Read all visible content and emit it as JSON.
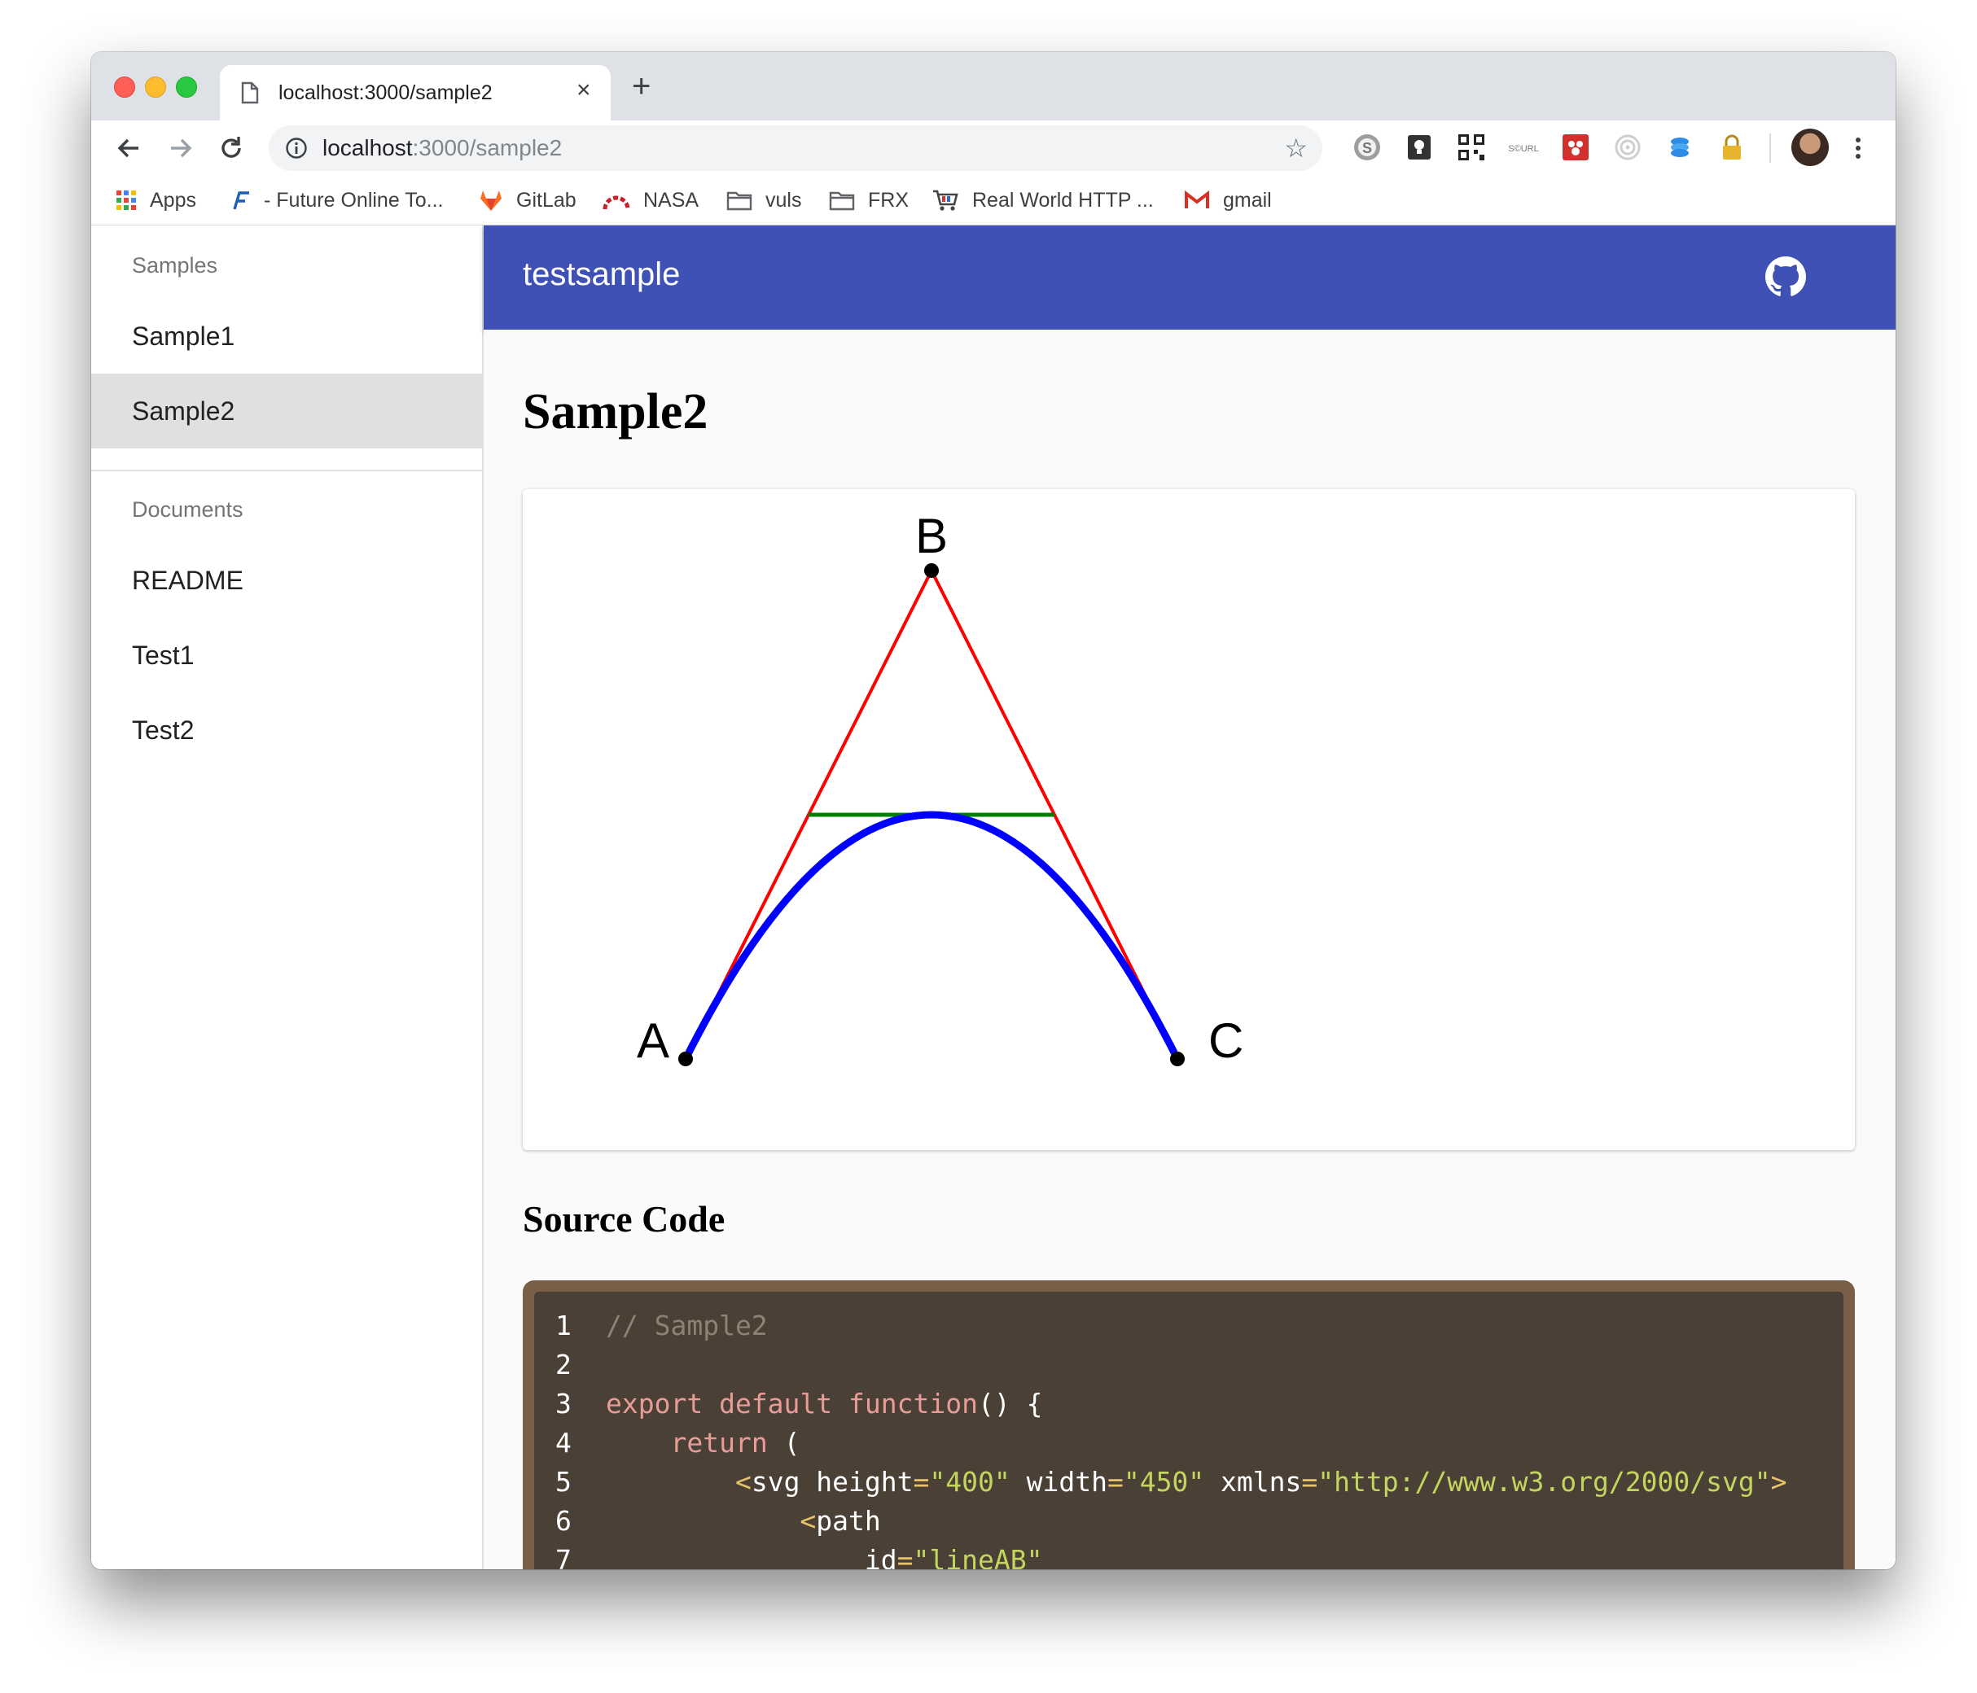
{
  "browser": {
    "tab_title": "localhost:3000/sample2",
    "tab_close": "×",
    "new_tab": "+",
    "url_host": "localhost",
    "url_rest": ":3000/sample2",
    "star": "☆",
    "bookmarks": [
      {
        "label": "Apps",
        "icon": "apps-grid-icon"
      },
      {
        "label": "- Future Online To...",
        "icon": "future-logo-icon"
      },
      {
        "label": "GitLab",
        "icon": "gitlab-icon"
      },
      {
        "label": "NASA",
        "icon": "nasa-arc-icon"
      },
      {
        "label": "vuls",
        "icon": "folder-icon"
      },
      {
        "label": "FRX",
        "icon": "folder-icon"
      },
      {
        "label": "Real World HTTP ...",
        "icon": "cart-icon"
      },
      {
        "label": "gmail",
        "icon": "gmail-icon"
      }
    ]
  },
  "sidebar": {
    "samples_header": "Samples",
    "samples": [
      "Sample1",
      "Sample2"
    ],
    "selected": "Sample2",
    "documents_header": "Documents",
    "documents": [
      "README",
      "Test1",
      "Test2"
    ]
  },
  "appbar": {
    "title": "testsample",
    "color": "#3f51b5"
  },
  "main": {
    "page_title": "Sample2",
    "section_title": "Source Code"
  },
  "diagram": {
    "labels": {
      "a": "A",
      "b": "B",
      "c": "C"
    },
    "colors": {
      "lines": "#ff0000",
      "mid": "#008000",
      "curve": "#0000ff",
      "points": "#000000"
    }
  },
  "code": {
    "lines": [
      {
        "n": "1",
        "parts": [
          [
            "c-comment",
            "// Sample2"
          ]
        ]
      },
      {
        "n": "2",
        "parts": []
      },
      {
        "n": "3",
        "parts": [
          [
            "c-kw",
            "export default function"
          ],
          [
            "c-plain",
            "() {"
          ]
        ]
      },
      {
        "n": "4",
        "parts": [
          [
            "c-plain",
            "    "
          ],
          [
            "c-kw",
            "return"
          ],
          [
            "c-plain",
            " ("
          ]
        ]
      },
      {
        "n": "5",
        "parts": [
          [
            "c-plain",
            "        "
          ],
          [
            "c-tag",
            "<"
          ],
          [
            "c-plain",
            "svg height"
          ],
          [
            "c-tag",
            "="
          ],
          [
            "c-str",
            "\"400\""
          ],
          [
            "c-plain",
            " width"
          ],
          [
            "c-tag",
            "="
          ],
          [
            "c-str",
            "\"450\""
          ],
          [
            "c-plain",
            " xmlns"
          ],
          [
            "c-tag",
            "="
          ],
          [
            "c-str",
            "\"http://www.w3.org/2000/svg\""
          ],
          [
            "c-tag",
            ">"
          ]
        ]
      },
      {
        "n": "6",
        "parts": [
          [
            "c-plain",
            "            "
          ],
          [
            "c-tag",
            "<"
          ],
          [
            "c-plain",
            "path"
          ]
        ]
      },
      {
        "n": "7",
        "parts": [
          [
            "c-plain",
            "                id"
          ],
          [
            "c-tag",
            "="
          ],
          [
            "c-str",
            "\"lineAB\""
          ]
        ]
      }
    ]
  }
}
